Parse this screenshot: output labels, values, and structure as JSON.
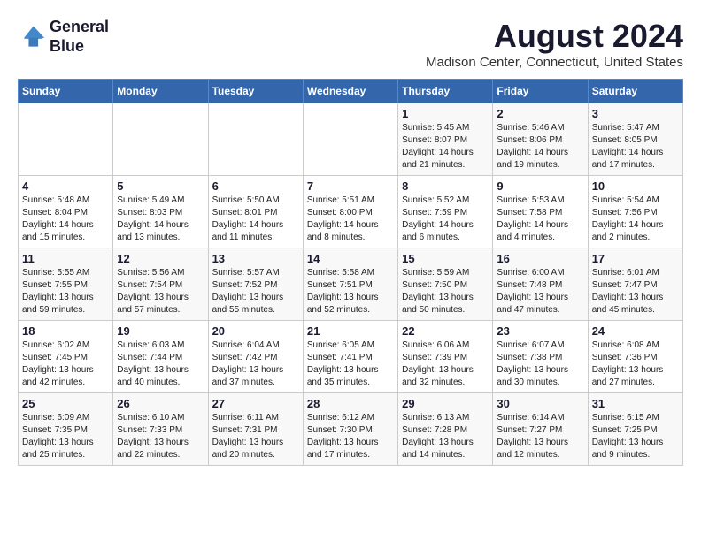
{
  "logo": {
    "line1": "General",
    "line2": "Blue"
  },
  "title": "August 2024",
  "location": "Madison Center, Connecticut, United States",
  "days_of_week": [
    "Sunday",
    "Monday",
    "Tuesday",
    "Wednesday",
    "Thursday",
    "Friday",
    "Saturday"
  ],
  "weeks": [
    [
      {
        "day": "",
        "info": ""
      },
      {
        "day": "",
        "info": ""
      },
      {
        "day": "",
        "info": ""
      },
      {
        "day": "",
        "info": ""
      },
      {
        "day": "1",
        "info": "Sunrise: 5:45 AM\nSunset: 8:07 PM\nDaylight: 14 hours\nand 21 minutes."
      },
      {
        "day": "2",
        "info": "Sunrise: 5:46 AM\nSunset: 8:06 PM\nDaylight: 14 hours\nand 19 minutes."
      },
      {
        "day": "3",
        "info": "Sunrise: 5:47 AM\nSunset: 8:05 PM\nDaylight: 14 hours\nand 17 minutes."
      }
    ],
    [
      {
        "day": "4",
        "info": "Sunrise: 5:48 AM\nSunset: 8:04 PM\nDaylight: 14 hours\nand 15 minutes."
      },
      {
        "day": "5",
        "info": "Sunrise: 5:49 AM\nSunset: 8:03 PM\nDaylight: 14 hours\nand 13 minutes."
      },
      {
        "day": "6",
        "info": "Sunrise: 5:50 AM\nSunset: 8:01 PM\nDaylight: 14 hours\nand 11 minutes."
      },
      {
        "day": "7",
        "info": "Sunrise: 5:51 AM\nSunset: 8:00 PM\nDaylight: 14 hours\nand 8 minutes."
      },
      {
        "day": "8",
        "info": "Sunrise: 5:52 AM\nSunset: 7:59 PM\nDaylight: 14 hours\nand 6 minutes."
      },
      {
        "day": "9",
        "info": "Sunrise: 5:53 AM\nSunset: 7:58 PM\nDaylight: 14 hours\nand 4 minutes."
      },
      {
        "day": "10",
        "info": "Sunrise: 5:54 AM\nSunset: 7:56 PM\nDaylight: 14 hours\nand 2 minutes."
      }
    ],
    [
      {
        "day": "11",
        "info": "Sunrise: 5:55 AM\nSunset: 7:55 PM\nDaylight: 13 hours\nand 59 minutes."
      },
      {
        "day": "12",
        "info": "Sunrise: 5:56 AM\nSunset: 7:54 PM\nDaylight: 13 hours\nand 57 minutes."
      },
      {
        "day": "13",
        "info": "Sunrise: 5:57 AM\nSunset: 7:52 PM\nDaylight: 13 hours\nand 55 minutes."
      },
      {
        "day": "14",
        "info": "Sunrise: 5:58 AM\nSunset: 7:51 PM\nDaylight: 13 hours\nand 52 minutes."
      },
      {
        "day": "15",
        "info": "Sunrise: 5:59 AM\nSunset: 7:50 PM\nDaylight: 13 hours\nand 50 minutes."
      },
      {
        "day": "16",
        "info": "Sunrise: 6:00 AM\nSunset: 7:48 PM\nDaylight: 13 hours\nand 47 minutes."
      },
      {
        "day": "17",
        "info": "Sunrise: 6:01 AM\nSunset: 7:47 PM\nDaylight: 13 hours\nand 45 minutes."
      }
    ],
    [
      {
        "day": "18",
        "info": "Sunrise: 6:02 AM\nSunset: 7:45 PM\nDaylight: 13 hours\nand 42 minutes."
      },
      {
        "day": "19",
        "info": "Sunrise: 6:03 AM\nSunset: 7:44 PM\nDaylight: 13 hours\nand 40 minutes."
      },
      {
        "day": "20",
        "info": "Sunrise: 6:04 AM\nSunset: 7:42 PM\nDaylight: 13 hours\nand 37 minutes."
      },
      {
        "day": "21",
        "info": "Sunrise: 6:05 AM\nSunset: 7:41 PM\nDaylight: 13 hours\nand 35 minutes."
      },
      {
        "day": "22",
        "info": "Sunrise: 6:06 AM\nSunset: 7:39 PM\nDaylight: 13 hours\nand 32 minutes."
      },
      {
        "day": "23",
        "info": "Sunrise: 6:07 AM\nSunset: 7:38 PM\nDaylight: 13 hours\nand 30 minutes."
      },
      {
        "day": "24",
        "info": "Sunrise: 6:08 AM\nSunset: 7:36 PM\nDaylight: 13 hours\nand 27 minutes."
      }
    ],
    [
      {
        "day": "25",
        "info": "Sunrise: 6:09 AM\nSunset: 7:35 PM\nDaylight: 13 hours\nand 25 minutes."
      },
      {
        "day": "26",
        "info": "Sunrise: 6:10 AM\nSunset: 7:33 PM\nDaylight: 13 hours\nand 22 minutes."
      },
      {
        "day": "27",
        "info": "Sunrise: 6:11 AM\nSunset: 7:31 PM\nDaylight: 13 hours\nand 20 minutes."
      },
      {
        "day": "28",
        "info": "Sunrise: 6:12 AM\nSunset: 7:30 PM\nDaylight: 13 hours\nand 17 minutes."
      },
      {
        "day": "29",
        "info": "Sunrise: 6:13 AM\nSunset: 7:28 PM\nDaylight: 13 hours\nand 14 minutes."
      },
      {
        "day": "30",
        "info": "Sunrise: 6:14 AM\nSunset: 7:27 PM\nDaylight: 13 hours\nand 12 minutes."
      },
      {
        "day": "31",
        "info": "Sunrise: 6:15 AM\nSunset: 7:25 PM\nDaylight: 13 hours\nand 9 minutes."
      }
    ]
  ]
}
